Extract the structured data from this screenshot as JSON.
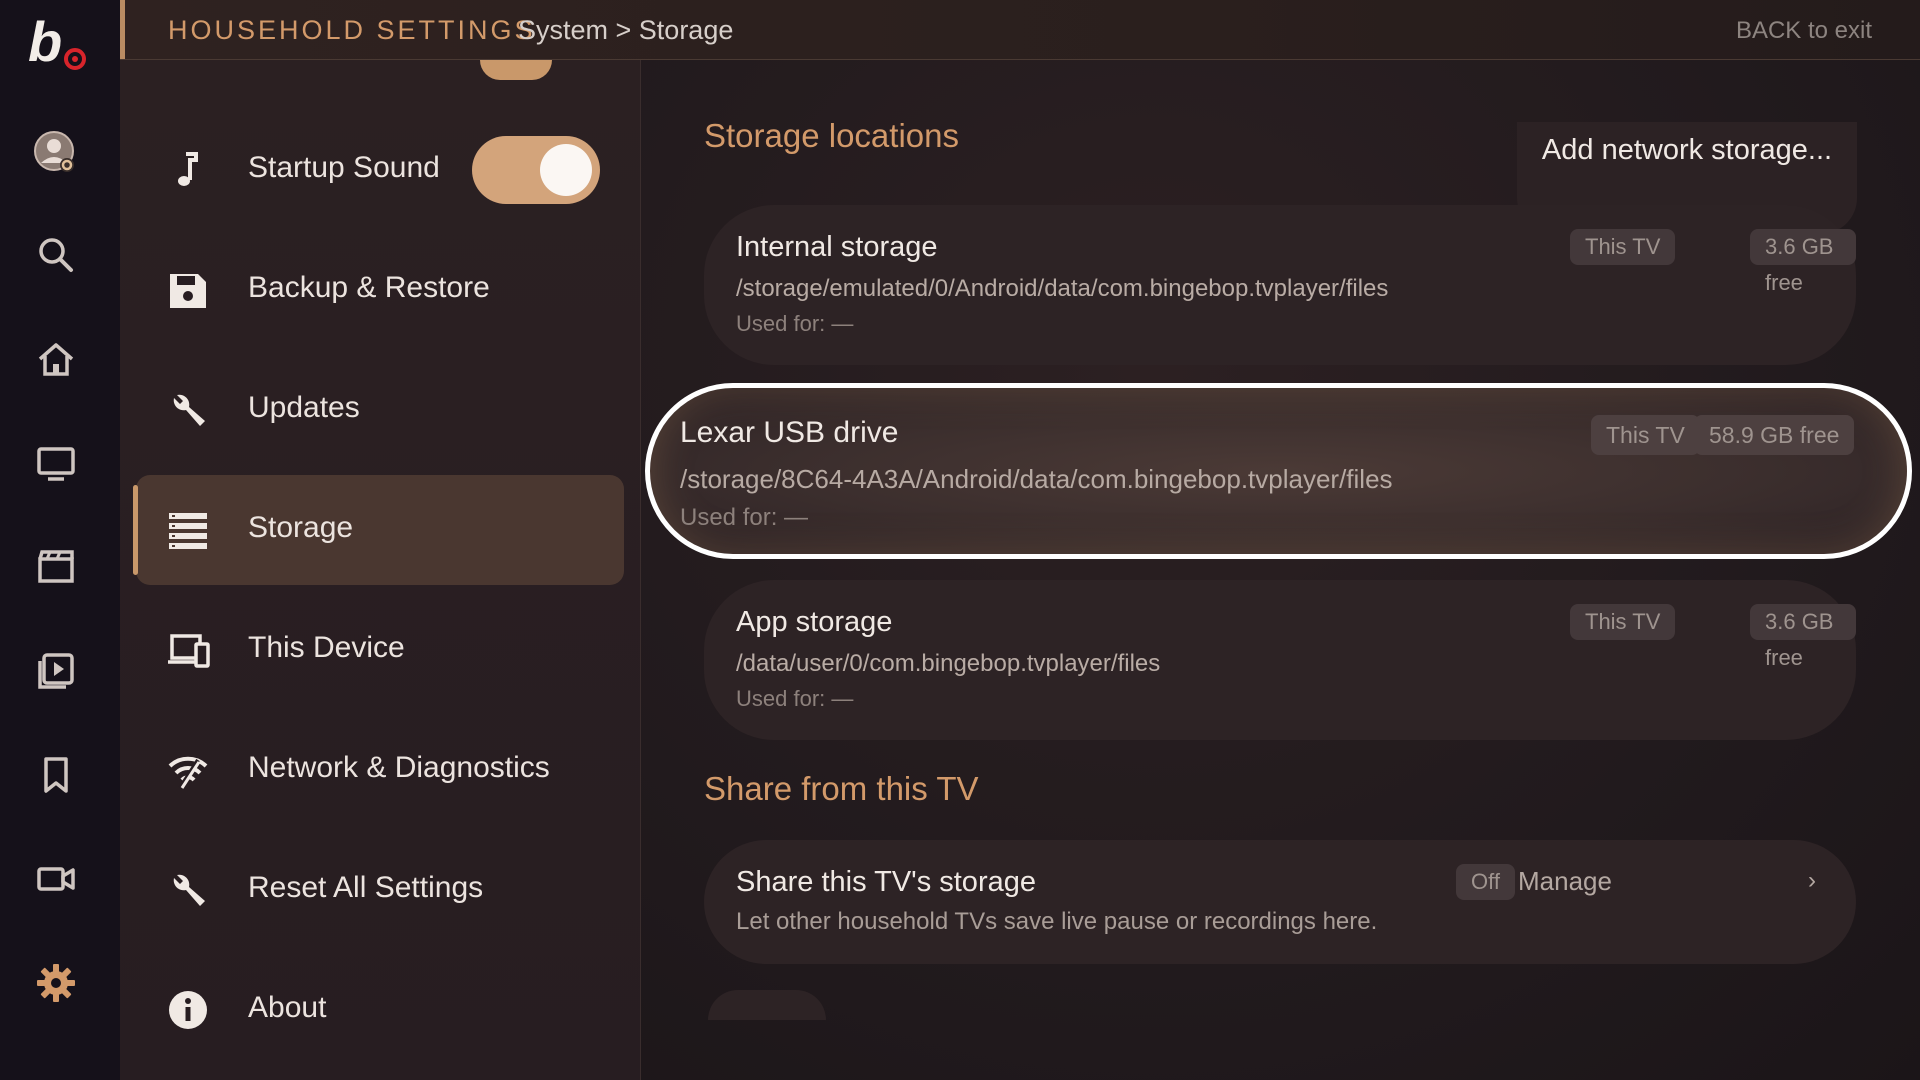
{
  "header": {
    "title": "HOUSEHOLD SETTINGS",
    "breadcrumb": "System > Storage",
    "back_hint": "BACK to exit"
  },
  "rail": {
    "logo_text": "b",
    "icons": [
      "avatar-icon",
      "search-icon",
      "home-icon",
      "tv-icon",
      "clapperboard-icon",
      "play-library-icon",
      "bookmark-icon",
      "video-camera-icon",
      "gear-icon"
    ],
    "active_icon": "gear-icon"
  },
  "menu": {
    "items": [
      {
        "label": "Startup Sound",
        "icon": "music-note-icon",
        "toggle": "on"
      },
      {
        "label": "Backup & Restore",
        "icon": "floppy-disk-icon"
      },
      {
        "label": "Updates",
        "icon": "wrench-icon"
      },
      {
        "label": "Storage",
        "icon": "storage-list-icon",
        "selected": true
      },
      {
        "label": "This Device",
        "icon": "devices-icon"
      },
      {
        "label": "Network & Diagnostics",
        "icon": "wifi-icon"
      },
      {
        "label": "Reset All Settings",
        "icon": "wrench-icon"
      },
      {
        "label": "About",
        "icon": "info-icon"
      }
    ]
  },
  "content": {
    "storage_locations_title": "Storage locations",
    "add_network_storage": "Add network storage...",
    "locations": [
      {
        "name": "Internal storage",
        "device": "This TV",
        "free": "3.6 GB free",
        "path": "/storage/emulated/0/Android/data/com.bingebop.tvplayer/files",
        "used_for": "Used for: —"
      },
      {
        "name": "Lexar USB drive",
        "device": "This TV",
        "free": "58.9 GB free",
        "path": "/storage/8C64-4A3A/Android/data/com.bingebop.tvplayer/files",
        "used_for": "Used for: —",
        "focused": true
      },
      {
        "name": "App storage",
        "device": "This TV",
        "free": "3.6 GB free",
        "path": "/data/user/0/com.bingebop.tvplayer/files",
        "used_for": "Used for: —"
      }
    ],
    "share_title": "Share from this TV",
    "share": {
      "name": "Share this TV's storage",
      "description": "Let other household TVs save live pause or recordings here.",
      "status": "Off",
      "manage": "Manage",
      "chevron": "›"
    }
  },
  "colors": {
    "accent": "#d39a6a",
    "toggle_on": "#d3a47b",
    "rail_bg": "#15111a",
    "focus_ring": "#ffffff"
  }
}
